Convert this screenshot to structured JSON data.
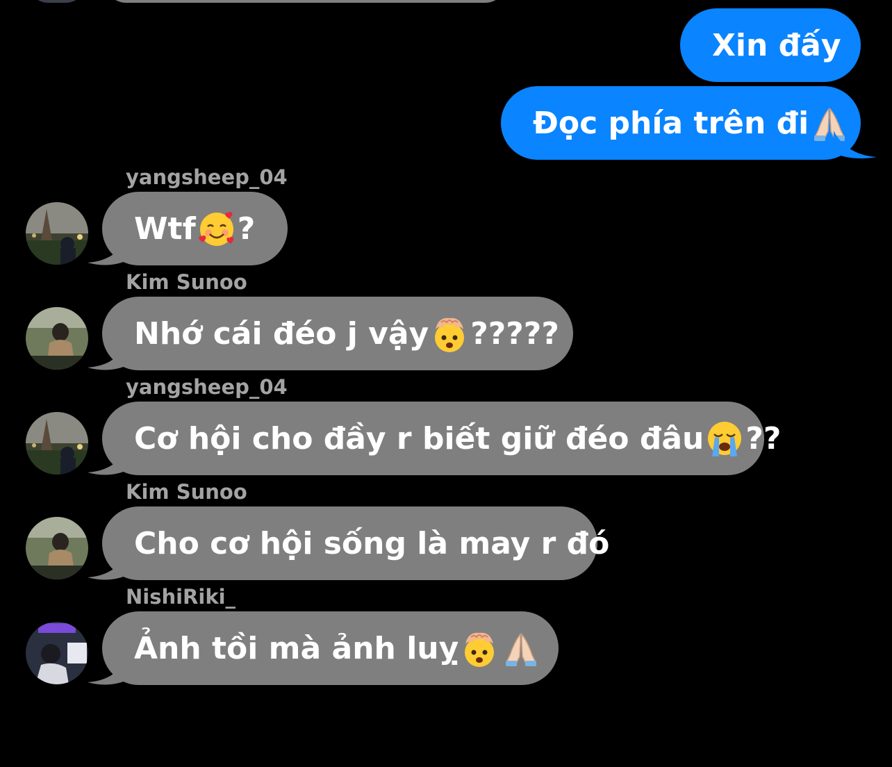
{
  "thread": {
    "messages": [
      {
        "direction": "outgoing",
        "text": "Xin đấy"
      },
      {
        "direction": "outgoing",
        "text": "Đọc phía trên đi",
        "emoji": [
          "folded-hands"
        ]
      },
      {
        "direction": "incoming",
        "sender": "yangsheep_04",
        "text_before": "Wtf",
        "emoji": [
          "smiling-face-with-hearts"
        ],
        "text_after": "?"
      },
      {
        "direction": "incoming",
        "sender": "Kim Sunoo",
        "text_before": "Nhớ cái đéo j vậy ",
        "emoji": [
          "exploding-head"
        ],
        "text_after": "?????"
      },
      {
        "direction": "incoming",
        "sender": "yangsheep_04",
        "text_before": "Cơ hội cho đầy r biết giữ đéo đâu",
        "emoji": [
          "loudly-crying-face"
        ],
        "text_after": "??"
      },
      {
        "direction": "incoming",
        "sender": "Kim Sunoo",
        "text": "Cho cơ hội sống là may r đó"
      },
      {
        "direction": "incoming",
        "sender": "NishiRiki_",
        "text_before": "Ảnh tồi mà ảnh luỵ ",
        "emoji": [
          "exploding-head",
          "folded-hands"
        ],
        "text_after": ""
      }
    ]
  },
  "colors": {
    "background": "#000000",
    "outgoing_bubble": "#0a84ff",
    "incoming_bubble": "#7f7f7f",
    "sender_name": "#a3a3a3",
    "message_text": "#ffffff"
  }
}
